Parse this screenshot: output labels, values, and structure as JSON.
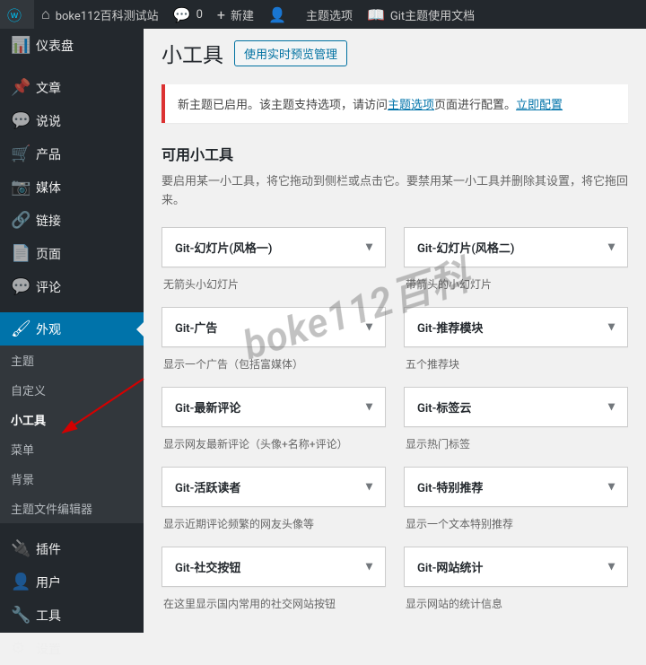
{
  "topbar": {
    "wp_icon": "ⓦ",
    "home_icon": "⌂",
    "site_name": "boke112百科测试站",
    "comment_icon": "💬",
    "comment_count": "0",
    "add_icon": "+",
    "add_label": "新建",
    "a11y_icon": "👤",
    "theme_options": "主题选项",
    "docs_icon": "📖",
    "docs_label": "Git主题使用文档"
  },
  "sidebar": {
    "items": [
      {
        "icon": "📊",
        "label": "仪表盘"
      },
      {
        "icon": "📌",
        "label": "文章"
      },
      {
        "icon": "💬",
        "label": "说说"
      },
      {
        "icon": "🛒",
        "label": "产品"
      },
      {
        "icon": "📷",
        "label": "媒体"
      },
      {
        "icon": "🔗",
        "label": "链接"
      },
      {
        "icon": "📄",
        "label": "页面"
      },
      {
        "icon": "💬",
        "label": "评论"
      },
      {
        "icon": "🖌",
        "label": "外观"
      }
    ],
    "submenu": [
      {
        "label": "主题"
      },
      {
        "label": "自定义"
      },
      {
        "label": "小工具"
      },
      {
        "label": "菜单"
      },
      {
        "label": "背景"
      },
      {
        "label": "主题文件编辑器"
      }
    ],
    "bottom": [
      {
        "icon": "🔌",
        "label": "插件"
      },
      {
        "icon": "👤",
        "label": "用户"
      },
      {
        "icon": "🔧",
        "label": "工具"
      },
      {
        "icon": "⚙",
        "label": "设置"
      }
    ]
  },
  "page": {
    "title": "小工具",
    "preview_btn": "使用实时预览管理",
    "notice_pre": "新主题已启用。该主题支持选项，请访问",
    "notice_link1": "主题选项",
    "notice_mid": "页面进行配置。",
    "notice_link2": "立即配置",
    "section_title": "可用小工具",
    "section_desc": "要启用某一小工具，将它拖动到侧栏或点击它。要禁用某一小工具并删除其设置，将它拖回来。"
  },
  "widgets": [
    {
      "title": "Git-幻灯片(风格一)",
      "desc": "无箭头小幻灯片"
    },
    {
      "title": "Git-幻灯片(风格二)",
      "desc": "带箭头的小幻灯片"
    },
    {
      "title": "Git-广告",
      "desc": "显示一个广告（包括富媒体）"
    },
    {
      "title": "Git-推荐模块",
      "desc": "五个推荐块"
    },
    {
      "title": "Git-最新评论",
      "desc": "显示网友最新评论（头像+名称+评论）"
    },
    {
      "title": "Git-标签云",
      "desc": "显示热门标签"
    },
    {
      "title": "Git-活跃读者",
      "desc": "显示近期评论频繁的网友头像等"
    },
    {
      "title": "Git-特别推荐",
      "desc": "显示一个文本特别推荐"
    },
    {
      "title": "Git-社交按钮",
      "desc": "在这里显示国内常用的社交网站按钮"
    },
    {
      "title": "Git-网站统计",
      "desc": "显示网站的统计信息"
    }
  ],
  "watermark": "boke112百科"
}
